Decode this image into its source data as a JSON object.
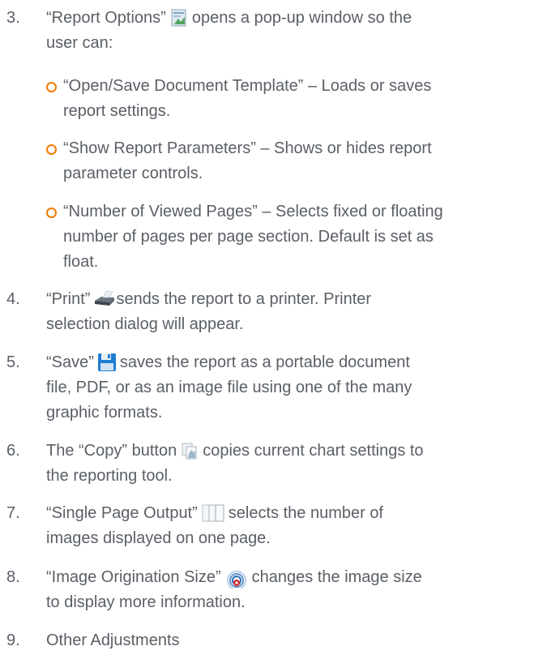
{
  "items": [
    {
      "number": "3.",
      "before": "“Report Options”",
      "icon": "report-options-icon",
      "after": "opens a pop-up window so the",
      "line2": "user can:",
      "subitems": [
        {
          "line1": "“Open/Save Document Template” – Loads or saves",
          "line2": "report settings."
        },
        {
          "line1": "“Show Report Parameters” – Shows or hides report",
          "line2": "parameter controls."
        },
        {
          "line1": "“Number of Viewed Pages” – Selects fixed or floating",
          "line2": "number of pages per page section. Default is set as",
          "line3": "float."
        }
      ]
    },
    {
      "number": "4.",
      "before": "“Print”",
      "icon": "printer-icon",
      "after": "sends the report to a printer. Printer",
      "line2": "selection dialog will appear."
    },
    {
      "number": "5.",
      "before": "“Save”",
      "icon": "floppy-disk-icon",
      "after": "saves the report as a portable document",
      "line2": "file, PDF, or as an image file using one of the many",
      "line3": "graphic formats."
    },
    {
      "number": "6.",
      "before": "The “Copy” button",
      "icon": "copy-icon",
      "after": "copies current chart settings to",
      "line2": "the reporting tool."
    },
    {
      "number": "7.",
      "before": "“Single Page Output”",
      "icon": "pages-icon",
      "after": "selects the number of",
      "line2": "images displayed on one page."
    },
    {
      "number": "8.",
      "before": "“Image Origination Size”",
      "icon": "image-size-icon",
      "after": "changes the image size",
      "line2": "to display more information."
    },
    {
      "number": "9.",
      "before": "Other Adjustments"
    }
  ],
  "colors": {
    "text": "#5a5f66",
    "bullet": "#f07c00"
  }
}
